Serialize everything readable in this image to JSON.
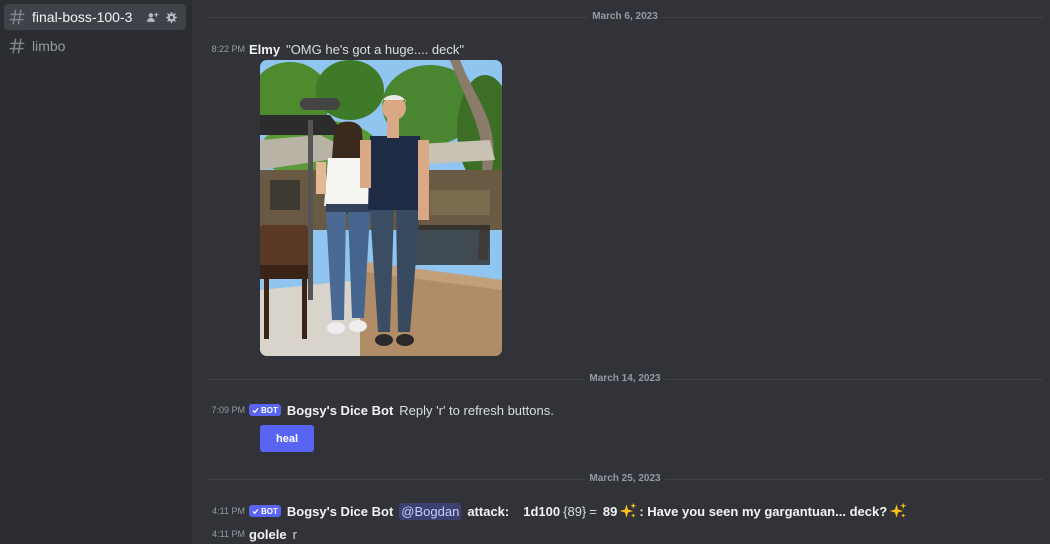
{
  "sidebar": {
    "channels": [
      {
        "name": "final-boss-100-3",
        "active": true
      },
      {
        "name": "limbo",
        "active": false
      }
    ]
  },
  "dividers": [
    "March 6, 2023",
    "March 14, 2023",
    "March 25, 2023"
  ],
  "messages": [
    {
      "time": "8:22 PM",
      "author": "Elmy",
      "text": "\"OMG he's got a huge.... deck\"",
      "image": "photo of two people standing outdoors on a patio with trees"
    },
    {
      "time": "7:09 PM",
      "badge": "BOT",
      "author": "Bogsy's Dice Bot",
      "text": "Reply 'r' to refresh buttons.",
      "button_label": "heal"
    },
    {
      "time": "4:11 PM",
      "badge": "BOT",
      "author": "Bogsy's Dice Bot",
      "mention": "@Bogdan",
      "attack_label": "attack:",
      "roll_expr": "1d100",
      "roll_detail": "{89}",
      "equals": "=",
      "roll_result": "89",
      "flavor": ": Have you seen my gargantuan... deck?"
    },
    {
      "time": "4:11 PM",
      "author": "golele",
      "text": "r"
    }
  ],
  "icons": {
    "channel": "hash-icon",
    "invite": "add-user-icon",
    "settings": "gear-icon",
    "verified": "check-icon",
    "sparkles": "sparkles-emoji"
  },
  "colors": {
    "background": "#313338",
    "sidebar": "#2b2d31",
    "active_channel": "#404249",
    "blurple": "#5865f2",
    "sparkle": "#fcc21b"
  }
}
